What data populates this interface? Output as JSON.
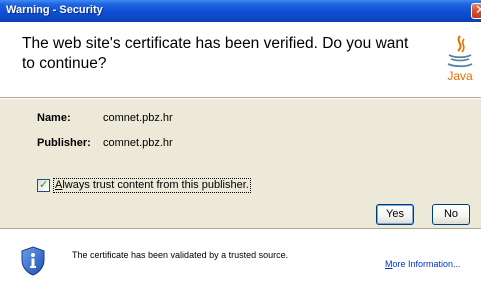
{
  "window": {
    "title": "Warning - Security",
    "close_glyph": "✕"
  },
  "header": {
    "message": "The web site's certificate has been verified.  Do you want to continue?",
    "logo_text": "Java",
    "logo_icon": "java-coffee-cup-icon"
  },
  "details": {
    "name_label": "Name:",
    "name_value": "comnet.pbz.hr",
    "publisher_label": "Publisher:",
    "publisher_value": "comnet.pbz.hr"
  },
  "trust_checkbox": {
    "label": "Always trust content from this publisher.",
    "checked": true
  },
  "buttons": {
    "yes": "Yes",
    "no": "No"
  },
  "footer": {
    "icon": "shield-info-icon",
    "message": "The certificate has been validated by a trusted source.",
    "more_info": "More Information..."
  },
  "colors": {
    "titlebar": "#0e4fd4",
    "panel": "#ece9d8",
    "link": "#0033cc"
  }
}
